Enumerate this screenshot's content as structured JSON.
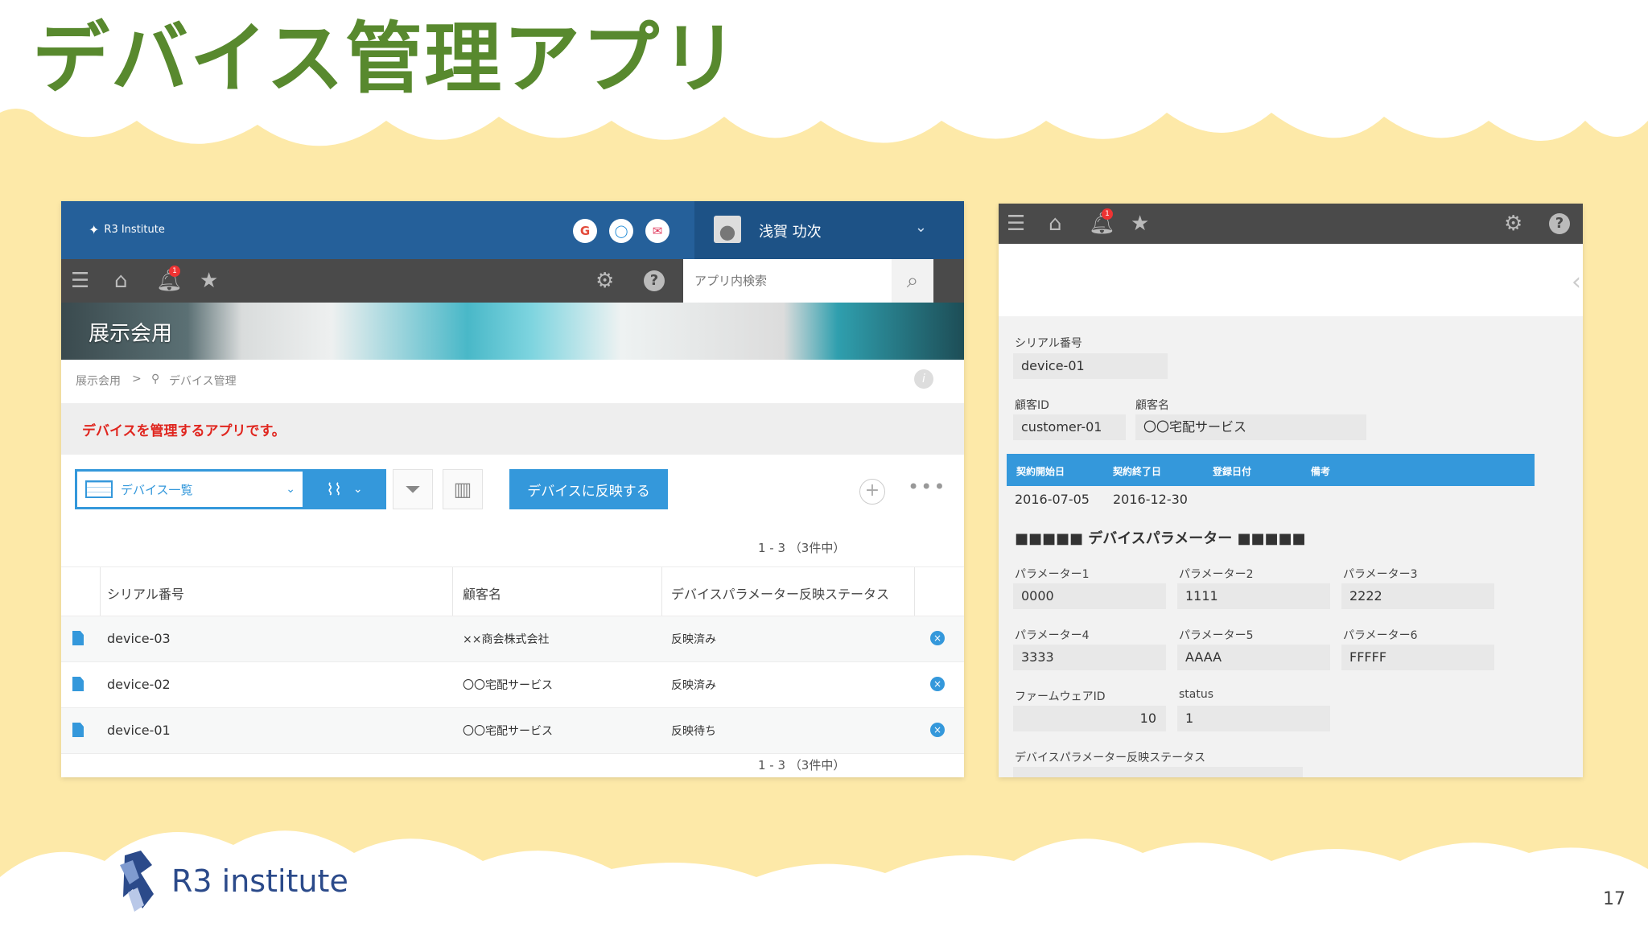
{
  "slide": {
    "title": "デバイス管理アプリ",
    "brand": "R3 institute",
    "page_number": "17"
  },
  "list_view": {
    "header": {
      "logo_text": "R3 Institute",
      "services": [
        {
          "icon": "g-icon",
          "glyph": "G",
          "color": "#e34b3b"
        },
        {
          "icon": "circle-icon",
          "glyph": "◯",
          "color": "#1e8ad6"
        },
        {
          "icon": "mail-icon",
          "glyph": "✉",
          "color": "#e0365a"
        }
      ],
      "user_name": "浅賀 功次"
    },
    "search_placeholder": "アプリ内検索",
    "banner_title": "展示会用",
    "breadcrumb": {
      "space": "展示会用",
      "separator": ">",
      "app": "デバイス管理"
    },
    "description": "デバイスを管理するアプリです。",
    "toolbar": {
      "view_name": "デバイス一覧",
      "reflect_button": "デバイスに反映する"
    },
    "pager_top": "1 - 3 （3件中）",
    "pager_bottom": "1 - 3 （3件中）",
    "columns": [
      "シリアル番号",
      "顧客名",
      "デバイスパラメーター反映ステータス"
    ],
    "rows": [
      {
        "serial": "device-03",
        "customer": "××商会株式会社",
        "status": "反映済み"
      },
      {
        "serial": "device-02",
        "customer": "〇〇宅配サービス",
        "status": "反映済み"
      },
      {
        "serial": "device-01",
        "customer": "〇〇宅配サービス",
        "status": "反映待ち"
      }
    ]
  },
  "record_view": {
    "serial_label": "シリアル番号",
    "serial_value": "device-01",
    "customer_id_label": "顧客ID",
    "customer_id_value": "customer-01",
    "customer_name_label": "顧客名",
    "customer_name_value": "〇〇宅配サービス",
    "contract_headers": [
      "契約開始日",
      "契約終了日",
      "登録日付",
      "備考"
    ],
    "contract_start": "2016-07-05",
    "contract_end": "2016-12-30",
    "param_section_title": "■■■■■ デバイスパラメーター ■■■■■",
    "params": [
      {
        "label": "パラメーター1",
        "value": "0000"
      },
      {
        "label": "パラメーター2",
        "value": "1111"
      },
      {
        "label": "パラメーター3",
        "value": "2222"
      },
      {
        "label": "パラメーター4",
        "value": "3333"
      },
      {
        "label": "パラメーター5",
        "value": "AAAA"
      },
      {
        "label": "パラメーター6",
        "value": "FFFFF"
      }
    ],
    "firmware_label": "ファームウェアID",
    "firmware_value": "10",
    "status_label": "status",
    "status_value": "1",
    "reflect_status_label": "デバイスパラメーター反映ステータス"
  },
  "icons": {
    "menu": "hamburger-icon",
    "home": "home-icon",
    "bell": "bell-icon",
    "star": "star-icon",
    "gear": "gear-icon",
    "help": "help-icon",
    "search": "search-icon"
  },
  "notification_count": "1"
}
